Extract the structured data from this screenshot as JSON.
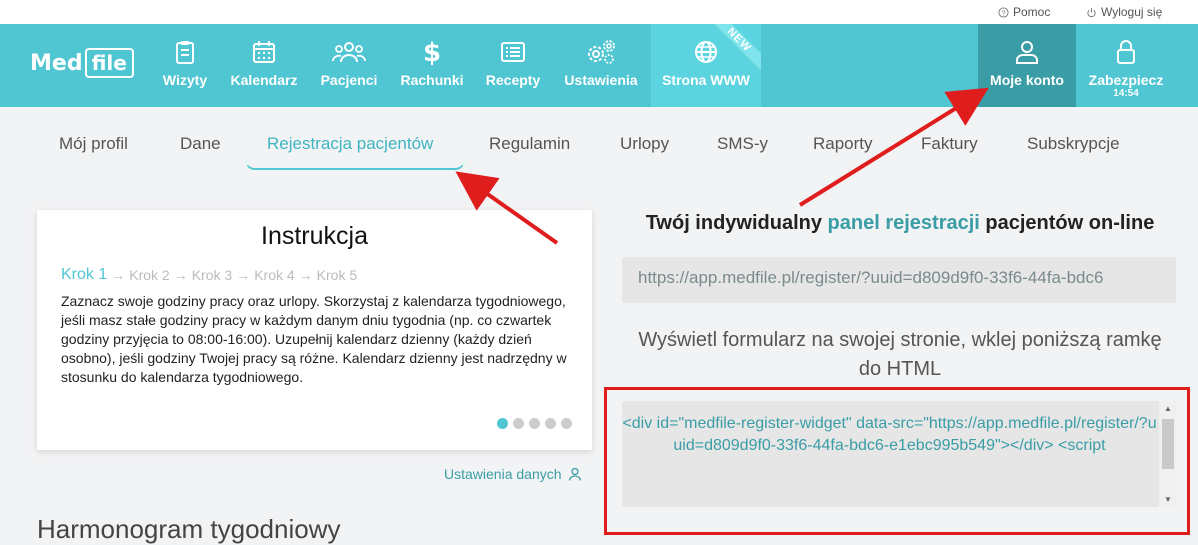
{
  "utility": {
    "help": "Pomoc",
    "logout": "Wyloguj się"
  },
  "logo": {
    "med": "Med",
    "file": "file"
  },
  "nav": {
    "items": [
      {
        "label": "Wizyty",
        "icon": "clipboard-icon"
      },
      {
        "label": "Kalendarz",
        "icon": "calendar-icon"
      },
      {
        "label": "Pacjenci",
        "icon": "users-icon"
      },
      {
        "label": "Rachunki",
        "icon": "dollar-icon"
      },
      {
        "label": "Recepty",
        "icon": "list-icon"
      },
      {
        "label": "Ustawienia",
        "icon": "gears-icon"
      },
      {
        "label": "Strona WWW",
        "icon": "globe-icon",
        "badge": "NEW"
      }
    ],
    "account": "Moje konto",
    "lock": "Zabezpiecz",
    "timer": "14:54"
  },
  "tabs": [
    "Mój profil",
    "Dane",
    "Rejestracja pacjentów",
    "Regulamin",
    "Urlopy",
    "SMS-y",
    "Raporty",
    "Faktury",
    "Subskrypcje"
  ],
  "active_tab": "Rejestracja pacjentów",
  "instruction": {
    "title": "Instrukcja",
    "steps": [
      "Krok 1",
      "Krok 2",
      "Krok 3",
      "Krok 4",
      "Krok 5"
    ],
    "current_step": 1,
    "text": "Zaznacz swoje godziny pracy oraz urlopy. Skorzystaj z kalendarza tygodniowego, jeśli masz stałe godziny pracy w każdym danym dniu tygodnia (np. co czwartek godziny przyjęcia to 08:00-16:00). Uzupełnij kalendarz dzienny (każdy dzień osobno), jeśli godziny Twojej pracy są różne. Kalendarz dzienny jest nadrzędny w stosunku do kalendarza tygodniowego.",
    "dots": 5
  },
  "settings_link": "Ustawienia danych",
  "section_title": "Harmonogram tygodniowy",
  "panel": {
    "heading_pre": "Twój indywidualny ",
    "heading_hl": "panel rejestracji",
    "heading_post": " pacjentów on-line",
    "url": "https://app.medfile.pl/register/?uuid=d809d9f0-33f6-44fa-bdc6",
    "embed_text": "Wyświetl formularz na swojej stronie, wklej poniższą ramkę do HTML",
    "code": "<div id=\"medfile-register-widget\" data-src=\"https://app.medfile.pl/register/?uuid=d809d9f0-33f6-44fa-bdc6-e1ebc995b549\"></div>\n<script"
  },
  "colors": {
    "brand": "#4fc6d1",
    "accent_dark": "#3a9da6",
    "annotation": "#e01d1d"
  }
}
